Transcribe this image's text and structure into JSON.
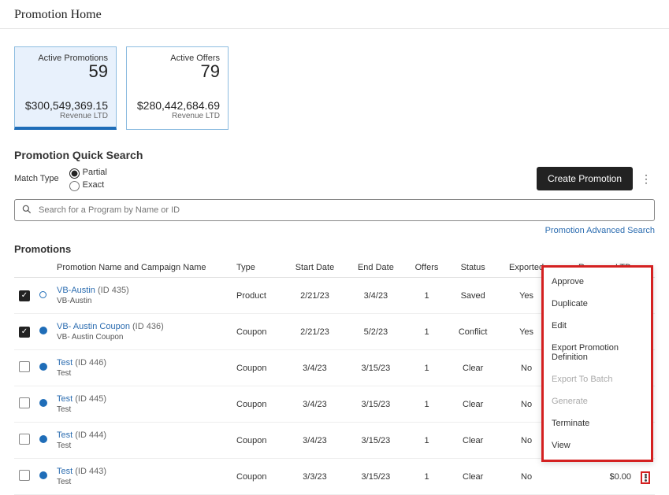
{
  "pageTitle": "Promotion Home",
  "cards": [
    {
      "label": "Active Promotions",
      "count": "59",
      "revenue": "$300,549,369.15",
      "sublabel": "Revenue LTD",
      "primary": true
    },
    {
      "label": "Active Offers",
      "count": "79",
      "revenue": "$280,442,684.69",
      "sublabel": "Revenue LTD",
      "primary": false
    }
  ],
  "quickSearch": {
    "title": "Promotion Quick Search",
    "matchTypeLabel": "Match Type",
    "radios": [
      {
        "label": "Partial",
        "checked": true
      },
      {
        "label": "Exact",
        "checked": false
      }
    ],
    "createBtn": "Create Promotion",
    "placeholder": "Search for a Program by Name or ID",
    "advanced": "Promotion Advanced Search"
  },
  "table": {
    "title": "Promotions",
    "columns": [
      "",
      "",
      "Promotion Name and Campaign Name",
      "Type",
      "Start Date",
      "End Date",
      "Offers",
      "Status",
      "Exported",
      "Revenue LTD",
      ""
    ],
    "rows": [
      {
        "checked": true,
        "dot": "hollow",
        "name": "VB-Austin",
        "id": "(ID 435)",
        "campaign": "VB-Austin",
        "type": "Product",
        "start": "2/21/23",
        "end": "3/4/23",
        "offers": "1",
        "status": "Saved",
        "exported": "Yes",
        "revenue": ""
      },
      {
        "checked": true,
        "dot": "solid",
        "name": "VB- Austin Coupon",
        "id": "(ID 436)",
        "campaign": "VB- Austin Coupon",
        "type": "Coupon",
        "start": "2/21/23",
        "end": "5/2/23",
        "offers": "1",
        "status": "Conflict",
        "exported": "Yes",
        "revenue": ""
      },
      {
        "checked": false,
        "dot": "solid",
        "name": "Test",
        "id": "(ID 446)",
        "campaign": "Test",
        "type": "Coupon",
        "start": "3/4/23",
        "end": "3/15/23",
        "offers": "1",
        "status": "Clear",
        "exported": "No",
        "revenue": ""
      },
      {
        "checked": false,
        "dot": "solid",
        "name": "Test",
        "id": "(ID 445)",
        "campaign": "Test",
        "type": "Coupon",
        "start": "3/4/23",
        "end": "3/15/23",
        "offers": "1",
        "status": "Clear",
        "exported": "No",
        "revenue": ""
      },
      {
        "checked": false,
        "dot": "solid",
        "name": "Test",
        "id": "(ID 444)",
        "campaign": "Test",
        "type": "Coupon",
        "start": "3/4/23",
        "end": "3/15/23",
        "offers": "1",
        "status": "Clear",
        "exported": "No",
        "revenue": ""
      },
      {
        "checked": false,
        "dot": "solid",
        "name": "Test",
        "id": "(ID 443)",
        "campaign": "Test",
        "type": "Coupon",
        "start": "3/3/23",
        "end": "3/15/23",
        "offers": "1",
        "status": "Clear",
        "exported": "No",
        "revenue": "$0.00",
        "menu": true
      }
    ]
  },
  "contextMenu": [
    {
      "label": "Approve",
      "disabled": false
    },
    {
      "label": "Duplicate",
      "disabled": false
    },
    {
      "label": "Edit",
      "disabled": false
    },
    {
      "label": "Export Promotion Definition",
      "disabled": false
    },
    {
      "label": "Export To Batch",
      "disabled": true
    },
    {
      "label": "Generate",
      "disabled": true
    },
    {
      "label": "Terminate",
      "disabled": false
    },
    {
      "label": "View",
      "disabled": false
    }
  ]
}
